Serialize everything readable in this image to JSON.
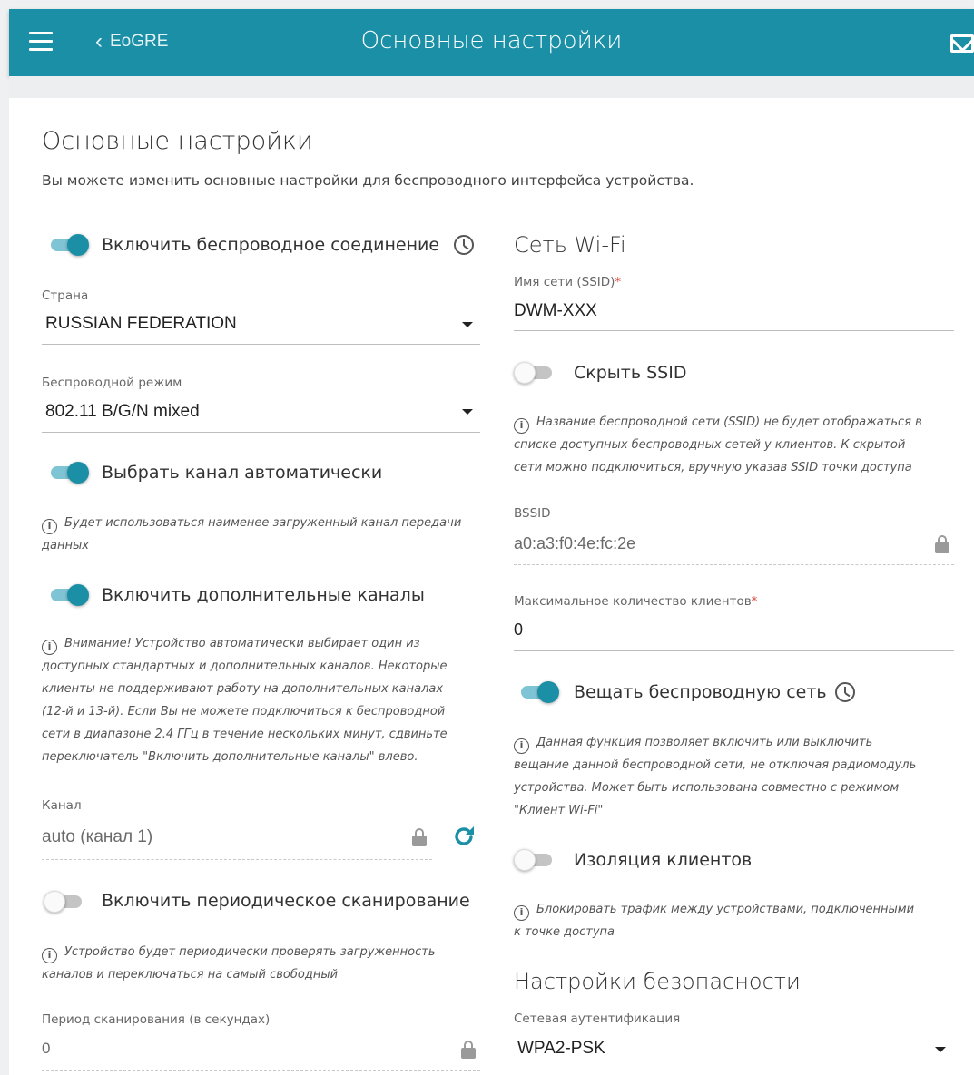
{
  "header": {
    "back_label": "EoGRE",
    "title": "Основные настройки"
  },
  "page": {
    "heading": "Основные настройки",
    "description": "Вы можете изменить основные настройки для беспроводного интерфейса устройства."
  },
  "left": {
    "enable_wireless": {
      "label": "Включить беспроводное соединение",
      "on": true
    },
    "country": {
      "label": "Страна",
      "value": "RUSSIAN FEDERATION"
    },
    "mode": {
      "label": "Беспроводной режим",
      "value": "802.11 B/G/N mixed"
    },
    "auto_channel": {
      "label": "Выбрать канал автоматически",
      "on": true,
      "note1": "Будет использоваться наименее загруженный канал передачи",
      "note2": "данных"
    },
    "extra_channels": {
      "label": "Включить дополнительные каналы",
      "on": true,
      "note1": "Внимание! Устройство автоматически выбирает один из",
      "note2": "доступных стандартных и дополнительных каналов. Некоторые",
      "note3": "клиенты не поддерживают работу на дополнительных каналах",
      "note4": "(12-й и 13-й). Если Вы не можете подключиться к беспроводной",
      "note5": "сети в диапазоне 2.4 ГГц в течение нескольких минут, сдвиньте",
      "note6": "переключатель \"Включить дополнительные каналы\" влево."
    },
    "channel": {
      "label": "Канал",
      "value": "auto (канал 1)"
    },
    "periodic_scan": {
      "label": "Включить периодическое сканирование",
      "on": false,
      "note1": "Устройство будет периодически проверять загруженность",
      "note2": "каналов и переключаться на самый свободный"
    },
    "scan_period": {
      "label": "Период сканирования (в секундах)",
      "value": "0"
    }
  },
  "right": {
    "wifi_heading": "Сеть Wi-Fi",
    "ssid": {
      "label": "Имя сети (SSID)",
      "required": "*",
      "value": "DWM-XXX"
    },
    "hide_ssid": {
      "label": "Скрыть SSID",
      "on": false,
      "note1": "Название беспроводной сети (SSID) не будет отображаться в",
      "note2": "списке доступных беспроводных сетей у клиентов. К скрытой",
      "note3": "сети можно подключиться, вручную указав SSID точки доступа"
    },
    "bssid": {
      "label": "BSSID",
      "value": "a0:a3:f0:4e:fc:2e"
    },
    "max_clients": {
      "label": "Максимальное количество клиентов",
      "required": "*",
      "value": "0"
    },
    "broadcast": {
      "label": "Вещать беспроводную сеть",
      "on": true,
      "note1": "Данная функция позволяет включить или выключить",
      "note2": "вещание данной беспроводной сети, не отключая радиомодуль",
      "note3": "устройства. Может быть использована совместно с режимом",
      "note4": "\"Клиент Wi-Fi\""
    },
    "isolation": {
      "label": "Изоляция клиентов",
      "on": false,
      "note1": "Блокировать трафик между устройствами, подключенными",
      "note2": "к точке доступа"
    },
    "security_heading": "Настройки безопасности",
    "auth": {
      "label": "Сетевая аутентификация",
      "value": "WPA2-PSK"
    }
  },
  "colors": {
    "accent": "#1a8fa6",
    "required": "#e0453b"
  },
  "icons": [
    "menu-icon",
    "chevron-left-icon",
    "mail-icon",
    "clock-icon",
    "info-icon",
    "lock-icon",
    "refresh-icon",
    "caret-down-icon"
  ]
}
